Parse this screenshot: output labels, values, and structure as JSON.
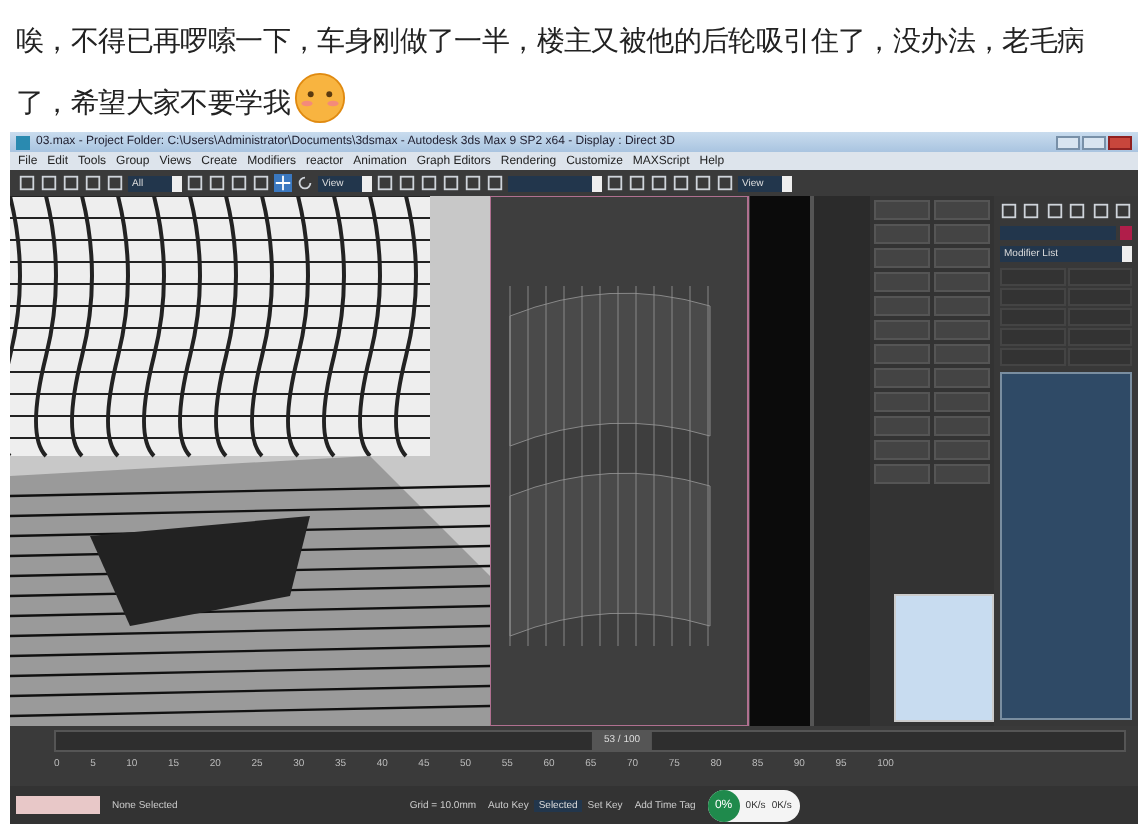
{
  "post": {
    "lines": [
      "唉，不得已再啰嗦一下，车身刚做了一半，楼主又被他的后轮吸引住了，没办法，老毛病",
      "了，希望大家不要学我"
    ]
  },
  "window": {
    "title": "03.max   - Project Folder: C:\\Users\\Administrator\\Documents\\3dsmax   - Autodesk 3ds Max 9 SP2 x64   - Display : Direct 3D"
  },
  "menu": [
    "File",
    "Edit",
    "Tools",
    "Group",
    "Views",
    "Create",
    "Modifiers",
    "reactor",
    "Animation",
    "Graph Editors",
    "Rendering",
    "Customize",
    "MAXScript",
    "Help"
  ],
  "toolbar": {
    "selection_filter": "All",
    "reference_coords": "View",
    "named_selection": "View"
  },
  "command_panel": {
    "modifier_list": "Modifier List"
  },
  "timeline": {
    "frame": "53 / 100",
    "level": 0.53,
    "ticks": [
      "0",
      "5",
      "10",
      "15",
      "20",
      "25",
      "30",
      "35",
      "40",
      "45",
      "50",
      "55",
      "60",
      "65",
      "70",
      "75",
      "80",
      "85",
      "90",
      "95",
      "100"
    ]
  },
  "status": {
    "selection": "None Selected",
    "grid": "Grid = 10.0mm",
    "auto_key": "Auto Key",
    "auto_key_value": "Selected",
    "set_key": "Set Key",
    "add_time_tag": "Add Time Tag"
  },
  "speed_widget": {
    "percent": "0%",
    "up": "0K/s",
    "down": "0K/s"
  }
}
